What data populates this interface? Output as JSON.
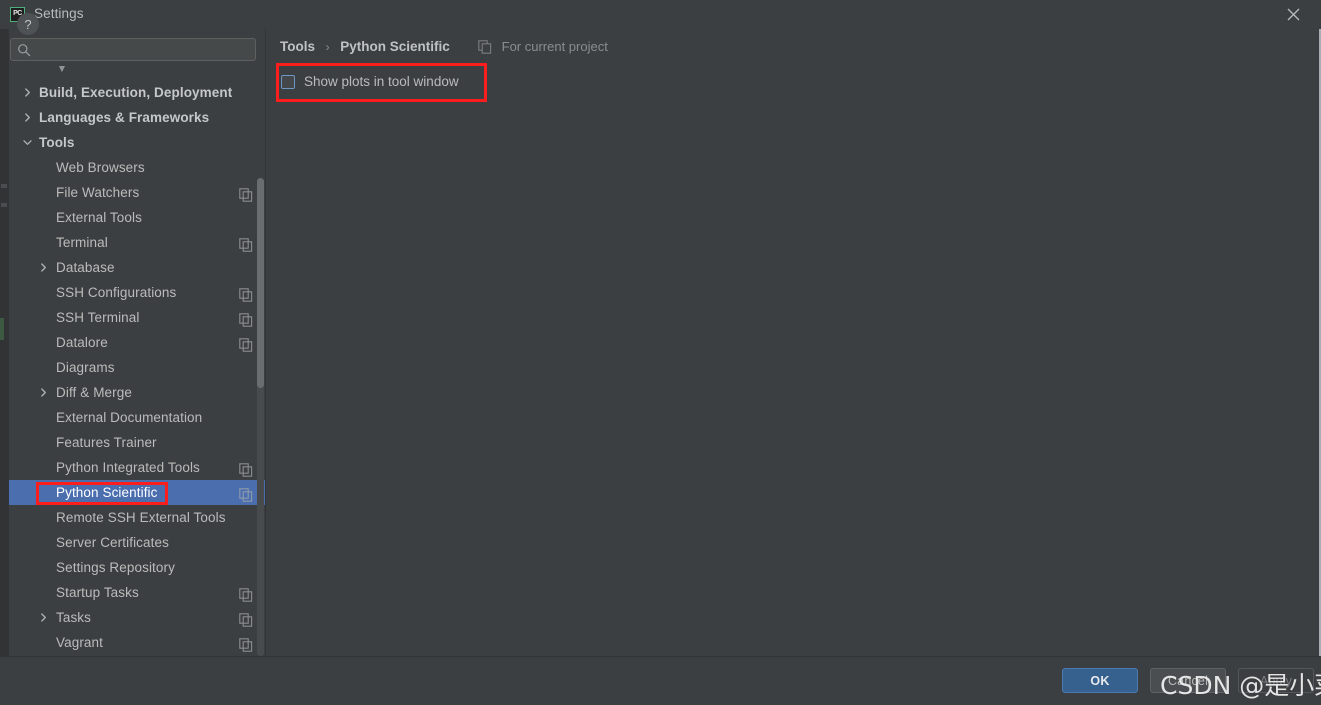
{
  "window": {
    "title": "Settings",
    "app_icon": "pycharm-icon",
    "close_icon": "close-icon"
  },
  "search": {
    "value": "",
    "placeholder": "",
    "icon": "search-icon"
  },
  "sidebar": {
    "scrollbar": "vertical-scrollbar",
    "items": [
      {
        "label": "",
        "level": "child",
        "twisty": "",
        "badge": false,
        "partial": true
      },
      {
        "label": "Build, Execution, Deployment",
        "level": "top",
        "twisty": "collapsed",
        "badge": false
      },
      {
        "label": "Languages & Frameworks",
        "level": "top",
        "twisty": "collapsed",
        "badge": false
      },
      {
        "label": "Tools",
        "level": "top",
        "twisty": "expanded",
        "badge": false
      },
      {
        "label": "Web Browsers",
        "level": "child",
        "twisty": "",
        "badge": false
      },
      {
        "label": "File Watchers",
        "level": "child",
        "twisty": "",
        "badge": true
      },
      {
        "label": "External Tools",
        "level": "child",
        "twisty": "",
        "badge": false
      },
      {
        "label": "Terminal",
        "level": "child",
        "twisty": "",
        "badge": true
      },
      {
        "label": "Database",
        "level": "child",
        "twisty": "collapsed",
        "badge": false
      },
      {
        "label": "SSH Configurations",
        "level": "child",
        "twisty": "",
        "badge": true
      },
      {
        "label": "SSH Terminal",
        "level": "child",
        "twisty": "",
        "badge": true
      },
      {
        "label": "Datalore",
        "level": "child",
        "twisty": "",
        "badge": true
      },
      {
        "label": "Diagrams",
        "level": "child",
        "twisty": "",
        "badge": false
      },
      {
        "label": "Diff & Merge",
        "level": "child",
        "twisty": "collapsed",
        "badge": false
      },
      {
        "label": "External Documentation",
        "level": "child",
        "twisty": "",
        "badge": false
      },
      {
        "label": "Features Trainer",
        "level": "child",
        "twisty": "",
        "badge": false
      },
      {
        "label": "Python Integrated Tools",
        "level": "child",
        "twisty": "",
        "badge": true
      },
      {
        "label": "Python Scientific",
        "level": "child",
        "twisty": "",
        "badge": true,
        "selected": true
      },
      {
        "label": "Remote SSH External Tools",
        "level": "child",
        "twisty": "",
        "badge": false
      },
      {
        "label": "Server Certificates",
        "level": "child",
        "twisty": "",
        "badge": false
      },
      {
        "label": "Settings Repository",
        "level": "child",
        "twisty": "",
        "badge": false
      },
      {
        "label": "Startup Tasks",
        "level": "child",
        "twisty": "",
        "badge": true
      },
      {
        "label": "Tasks",
        "level": "child",
        "twisty": "collapsed",
        "badge": true
      },
      {
        "label": "Vagrant",
        "level": "child",
        "twisty": "",
        "badge": true
      }
    ]
  },
  "content": {
    "breadcrumb": {
      "parent": "Tools",
      "separator": "›",
      "current": "Python Scientific"
    },
    "scope": {
      "icon": "copy-scope-icon",
      "label": "For current project"
    },
    "options": [
      {
        "label": "Show plots in tool window",
        "checked": false,
        "name": "show-plots-in-tool-window-checkbox"
      }
    ]
  },
  "annotations": [
    {
      "name": "highlight-checkbox",
      "color": "#fc1d1d"
    },
    {
      "name": "highlight-tree-item",
      "color": "#fc1d1d"
    }
  ],
  "footer": {
    "help_label": "?",
    "ok_label": "OK",
    "cancel_label": "Cancel",
    "apply_label": "Apply"
  },
  "watermark": {
    "text": "CSDN @是小菜欸"
  },
  "colors": {
    "background": "#3c3f41",
    "selection": "#4b6eaf",
    "accent": "#36618f",
    "annotation": "#fc1d1d",
    "text": "#bbbbbb"
  }
}
